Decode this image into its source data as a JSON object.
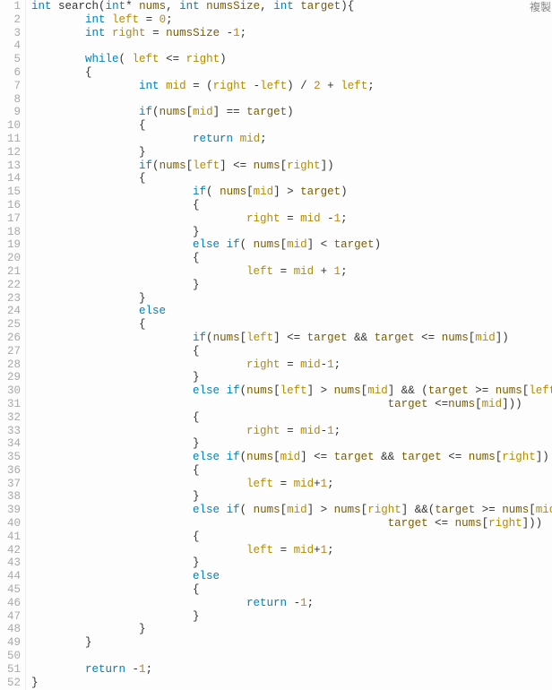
{
  "copy_label": "複製",
  "line_count": 52,
  "tokens": {
    "kw": [
      "int",
      "while",
      "if",
      "else",
      "return"
    ],
    "vars": [
      "left",
      "right",
      "mid"
    ],
    "params": [
      "nums",
      "numsSize",
      "target"
    ],
    "fn": "search"
  },
  "lines": [
    {
      "n": 1,
      "seg": [
        [
          "kw",
          "int"
        ],
        [
          "pn",
          " "
        ],
        [
          "fn",
          "search"
        ],
        [
          "pn",
          "("
        ],
        [
          "kw",
          "int"
        ],
        [
          "pn",
          "* "
        ],
        [
          "builtin",
          "nums"
        ],
        [
          "pn",
          ", "
        ],
        [
          "kw",
          "int"
        ],
        [
          "pn",
          " "
        ],
        [
          "builtin",
          "numsSize"
        ],
        [
          "pn",
          ", "
        ],
        [
          "kw",
          "int"
        ],
        [
          "pn",
          " "
        ],
        [
          "builtin",
          "target"
        ],
        [
          "pn",
          "){"
        ]
      ]
    },
    {
      "n": 2,
      "seg": [
        [
          "pn",
          "        "
        ],
        [
          "kw",
          "int"
        ],
        [
          "pn",
          " "
        ],
        [
          "id-var",
          "left"
        ],
        [
          "pn",
          " = "
        ],
        [
          "num",
          "0"
        ],
        [
          "pn",
          ";"
        ]
      ]
    },
    {
      "n": 3,
      "seg": [
        [
          "pn",
          "        "
        ],
        [
          "kw",
          "int"
        ],
        [
          "pn",
          " "
        ],
        [
          "id-var",
          "right"
        ],
        [
          "pn",
          " = "
        ],
        [
          "builtin",
          "numsSize"
        ],
        [
          "pn",
          " -"
        ],
        [
          "num",
          "1"
        ],
        [
          "pn",
          ";"
        ]
      ]
    },
    {
      "n": 4,
      "seg": [
        [
          "pn",
          ""
        ]
      ]
    },
    {
      "n": 5,
      "seg": [
        [
          "pn",
          "        "
        ],
        [
          "kw",
          "while"
        ],
        [
          "pn",
          "( "
        ],
        [
          "id-var",
          "left"
        ],
        [
          "pn",
          " <= "
        ],
        [
          "id-var",
          "right"
        ],
        [
          "pn",
          ")"
        ]
      ]
    },
    {
      "n": 6,
      "seg": [
        [
          "pn",
          "        {"
        ]
      ]
    },
    {
      "n": 7,
      "seg": [
        [
          "pn",
          "                "
        ],
        [
          "kw",
          "int"
        ],
        [
          "pn",
          " "
        ],
        [
          "id-var",
          "mid"
        ],
        [
          "pn",
          " = ("
        ],
        [
          "id-var",
          "right"
        ],
        [
          "pn",
          " -"
        ],
        [
          "id-var",
          "left"
        ],
        [
          "pn",
          ") / "
        ],
        [
          "num",
          "2"
        ],
        [
          "pn",
          " + "
        ],
        [
          "id-var",
          "left"
        ],
        [
          "pn",
          ";"
        ]
      ]
    },
    {
      "n": 8,
      "seg": [
        [
          "pn",
          ""
        ]
      ]
    },
    {
      "n": 9,
      "seg": [
        [
          "pn",
          "                "
        ],
        [
          "kw",
          "if"
        ],
        [
          "pn",
          "("
        ],
        [
          "builtin",
          "nums"
        ],
        [
          "pn",
          "["
        ],
        [
          "id-var",
          "mid"
        ],
        [
          "pn",
          "] == "
        ],
        [
          "builtin",
          "target"
        ],
        [
          "pn",
          ")"
        ]
      ]
    },
    {
      "n": 10,
      "seg": [
        [
          "pn",
          "                {"
        ]
      ]
    },
    {
      "n": 11,
      "seg": [
        [
          "pn",
          "                        "
        ],
        [
          "kw",
          "return"
        ],
        [
          "pn",
          " "
        ],
        [
          "id-var",
          "mid"
        ],
        [
          "pn",
          ";"
        ]
      ]
    },
    {
      "n": 12,
      "seg": [
        [
          "pn",
          "                }"
        ]
      ]
    },
    {
      "n": 13,
      "seg": [
        [
          "pn",
          "                "
        ],
        [
          "kw",
          "if"
        ],
        [
          "pn",
          "("
        ],
        [
          "builtin",
          "nums"
        ],
        [
          "pn",
          "["
        ],
        [
          "id-var",
          "left"
        ],
        [
          "pn",
          "] <= "
        ],
        [
          "builtin",
          "nums"
        ],
        [
          "pn",
          "["
        ],
        [
          "id-var",
          "right"
        ],
        [
          "pn",
          "])"
        ]
      ]
    },
    {
      "n": 14,
      "seg": [
        [
          "pn",
          "                {"
        ]
      ]
    },
    {
      "n": 15,
      "seg": [
        [
          "pn",
          "                        "
        ],
        [
          "kw",
          "if"
        ],
        [
          "pn",
          "( "
        ],
        [
          "builtin",
          "nums"
        ],
        [
          "pn",
          "["
        ],
        [
          "id-var",
          "mid"
        ],
        [
          "pn",
          "] > "
        ],
        [
          "builtin",
          "target"
        ],
        [
          "pn",
          ")"
        ]
      ]
    },
    {
      "n": 16,
      "seg": [
        [
          "pn",
          "                        {"
        ]
      ]
    },
    {
      "n": 17,
      "seg": [
        [
          "pn",
          "                                "
        ],
        [
          "id-var",
          "right"
        ],
        [
          "pn",
          " = "
        ],
        [
          "id-var",
          "mid"
        ],
        [
          "pn",
          " -"
        ],
        [
          "num",
          "1"
        ],
        [
          "pn",
          ";"
        ]
      ]
    },
    {
      "n": 18,
      "seg": [
        [
          "pn",
          "                        }"
        ]
      ]
    },
    {
      "n": 19,
      "seg": [
        [
          "pn",
          "                        "
        ],
        [
          "kw",
          "else"
        ],
        [
          "pn",
          " "
        ],
        [
          "kw",
          "if"
        ],
        [
          "pn",
          "( "
        ],
        [
          "builtin",
          "nums"
        ],
        [
          "pn",
          "["
        ],
        [
          "id-var",
          "mid"
        ],
        [
          "pn",
          "] < "
        ],
        [
          "builtin",
          "target"
        ],
        [
          "pn",
          ")"
        ]
      ]
    },
    {
      "n": 20,
      "seg": [
        [
          "pn",
          "                        {"
        ]
      ]
    },
    {
      "n": 21,
      "seg": [
        [
          "pn",
          "                                "
        ],
        [
          "id-var",
          "left"
        ],
        [
          "pn",
          " = "
        ],
        [
          "id-var",
          "mid"
        ],
        [
          "pn",
          " + "
        ],
        [
          "num",
          "1"
        ],
        [
          "pn",
          ";"
        ]
      ]
    },
    {
      "n": 22,
      "seg": [
        [
          "pn",
          "                        }"
        ]
      ]
    },
    {
      "n": 23,
      "seg": [
        [
          "pn",
          "                }"
        ]
      ]
    },
    {
      "n": 24,
      "seg": [
        [
          "pn",
          "                "
        ],
        [
          "kw",
          "else"
        ]
      ]
    },
    {
      "n": 25,
      "seg": [
        [
          "pn",
          "                {"
        ]
      ]
    },
    {
      "n": 26,
      "seg": [
        [
          "pn",
          "                        "
        ],
        [
          "kw",
          "if"
        ],
        [
          "pn",
          "("
        ],
        [
          "builtin",
          "nums"
        ],
        [
          "pn",
          "["
        ],
        [
          "id-var",
          "left"
        ],
        [
          "pn",
          "] <= "
        ],
        [
          "builtin",
          "target"
        ],
        [
          "pn",
          " && "
        ],
        [
          "builtin",
          "target"
        ],
        [
          "pn",
          " <= "
        ],
        [
          "builtin",
          "nums"
        ],
        [
          "pn",
          "["
        ],
        [
          "id-var",
          "mid"
        ],
        [
          "pn",
          "])"
        ]
      ]
    },
    {
      "n": 27,
      "seg": [
        [
          "pn",
          "                        {"
        ]
      ]
    },
    {
      "n": 28,
      "seg": [
        [
          "pn",
          "                                "
        ],
        [
          "id-var",
          "right"
        ],
        [
          "pn",
          " = "
        ],
        [
          "id-var",
          "mid"
        ],
        [
          "pn",
          "-"
        ],
        [
          "num",
          "1"
        ],
        [
          "pn",
          ";"
        ]
      ]
    },
    {
      "n": 29,
      "seg": [
        [
          "pn",
          "                        }"
        ]
      ]
    },
    {
      "n": 30,
      "seg": [
        [
          "pn",
          "                        "
        ],
        [
          "kw",
          "else"
        ],
        [
          "pn",
          " "
        ],
        [
          "kw",
          "if"
        ],
        [
          "pn",
          "("
        ],
        [
          "builtin",
          "nums"
        ],
        [
          "pn",
          "["
        ],
        [
          "id-var",
          "left"
        ],
        [
          "pn",
          "] > "
        ],
        [
          "builtin",
          "nums"
        ],
        [
          "pn",
          "["
        ],
        [
          "id-var",
          "mid"
        ],
        [
          "pn",
          "] && ("
        ],
        [
          "builtin",
          "target"
        ],
        [
          "pn",
          " >= "
        ],
        [
          "builtin",
          "nums"
        ],
        [
          "pn",
          "["
        ],
        [
          "id-var",
          "left"
        ],
        [
          "pn",
          "] ||"
        ]
      ]
    },
    {
      "n": 31,
      "seg": [
        [
          "pn",
          "                                                     "
        ],
        [
          "builtin",
          "target"
        ],
        [
          "pn",
          " <="
        ],
        [
          "builtin",
          "nums"
        ],
        [
          "pn",
          "["
        ],
        [
          "id-var",
          "mid"
        ],
        [
          "pn",
          "]))"
        ]
      ]
    },
    {
      "n": 32,
      "seg": [
        [
          "pn",
          "                        {"
        ]
      ]
    },
    {
      "n": 33,
      "seg": [
        [
          "pn",
          "                                "
        ],
        [
          "id-var",
          "right"
        ],
        [
          "pn",
          " = "
        ],
        [
          "id-var",
          "mid"
        ],
        [
          "pn",
          "-"
        ],
        [
          "num",
          "1"
        ],
        [
          "pn",
          ";"
        ]
      ]
    },
    {
      "n": 34,
      "seg": [
        [
          "pn",
          "                        }"
        ]
      ]
    },
    {
      "n": 35,
      "seg": [
        [
          "pn",
          "                        "
        ],
        [
          "kw",
          "else"
        ],
        [
          "pn",
          " "
        ],
        [
          "kw",
          "if"
        ],
        [
          "pn",
          "("
        ],
        [
          "builtin",
          "nums"
        ],
        [
          "pn",
          "["
        ],
        [
          "id-var",
          "mid"
        ],
        [
          "pn",
          "] <= "
        ],
        [
          "builtin",
          "target"
        ],
        [
          "pn",
          " && "
        ],
        [
          "builtin",
          "target"
        ],
        [
          "pn",
          " <= "
        ],
        [
          "builtin",
          "nums"
        ],
        [
          "pn",
          "["
        ],
        [
          "id-var",
          "right"
        ],
        [
          "pn",
          "])"
        ]
      ]
    },
    {
      "n": 36,
      "seg": [
        [
          "pn",
          "                        {"
        ]
      ]
    },
    {
      "n": 37,
      "seg": [
        [
          "pn",
          "                                "
        ],
        [
          "id-var",
          "left"
        ],
        [
          "pn",
          " = "
        ],
        [
          "id-var",
          "mid"
        ],
        [
          "pn",
          "+"
        ],
        [
          "num",
          "1"
        ],
        [
          "pn",
          ";"
        ]
      ]
    },
    {
      "n": 38,
      "seg": [
        [
          "pn",
          "                        }"
        ]
      ]
    },
    {
      "n": 39,
      "seg": [
        [
          "pn",
          "                        "
        ],
        [
          "kw",
          "else"
        ],
        [
          "pn",
          " "
        ],
        [
          "kw",
          "if"
        ],
        [
          "pn",
          "( "
        ],
        [
          "builtin",
          "nums"
        ],
        [
          "pn",
          "["
        ],
        [
          "id-var",
          "mid"
        ],
        [
          "pn",
          "] > "
        ],
        [
          "builtin",
          "nums"
        ],
        [
          "pn",
          "["
        ],
        [
          "id-var",
          "right"
        ],
        [
          "pn",
          "] &&("
        ],
        [
          "builtin",
          "target"
        ],
        [
          "pn",
          " >= "
        ],
        [
          "builtin",
          "nums"
        ],
        [
          "pn",
          "["
        ],
        [
          "id-var",
          "mid"
        ],
        [
          "pn",
          "] ||"
        ]
      ]
    },
    {
      "n": 40,
      "seg": [
        [
          "pn",
          "                                                     "
        ],
        [
          "builtin",
          "target"
        ],
        [
          "pn",
          " <= "
        ],
        [
          "builtin",
          "nums"
        ],
        [
          "pn",
          "["
        ],
        [
          "id-var",
          "right"
        ],
        [
          "pn",
          "]))"
        ]
      ]
    },
    {
      "n": 41,
      "seg": [
        [
          "pn",
          "                        {"
        ]
      ]
    },
    {
      "n": 42,
      "seg": [
        [
          "pn",
          "                                "
        ],
        [
          "id-var",
          "left"
        ],
        [
          "pn",
          " = "
        ],
        [
          "id-var",
          "mid"
        ],
        [
          "pn",
          "+"
        ],
        [
          "num",
          "1"
        ],
        [
          "pn",
          ";"
        ]
      ]
    },
    {
      "n": 43,
      "seg": [
        [
          "pn",
          "                        }"
        ]
      ]
    },
    {
      "n": 44,
      "seg": [
        [
          "pn",
          "                        "
        ],
        [
          "kw",
          "else"
        ]
      ]
    },
    {
      "n": 45,
      "seg": [
        [
          "pn",
          "                        {"
        ]
      ]
    },
    {
      "n": 46,
      "seg": [
        [
          "pn",
          "                                "
        ],
        [
          "kw",
          "return"
        ],
        [
          "pn",
          " -"
        ],
        [
          "num",
          "1"
        ],
        [
          "pn",
          ";"
        ]
      ]
    },
    {
      "n": 47,
      "seg": [
        [
          "pn",
          "                        }"
        ]
      ]
    },
    {
      "n": 48,
      "seg": [
        [
          "pn",
          "                }"
        ]
      ]
    },
    {
      "n": 49,
      "seg": [
        [
          "pn",
          "        }"
        ]
      ]
    },
    {
      "n": 50,
      "seg": [
        [
          "pn",
          ""
        ]
      ]
    },
    {
      "n": 51,
      "seg": [
        [
          "pn",
          "        "
        ],
        [
          "kw",
          "return"
        ],
        [
          "pn",
          " -"
        ],
        [
          "num",
          "1"
        ],
        [
          "pn",
          ";"
        ]
      ]
    },
    {
      "n": 52,
      "seg": [
        [
          "pn",
          "}"
        ]
      ]
    }
  ]
}
